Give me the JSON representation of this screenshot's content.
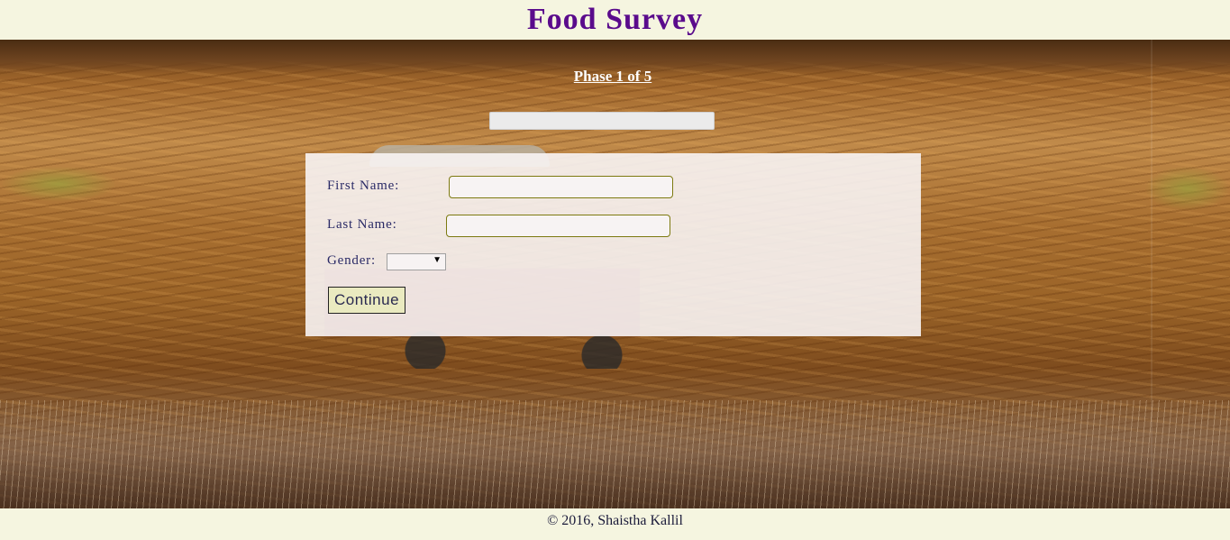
{
  "header": {
    "title": "Food Survey"
  },
  "survey": {
    "phase_label": "Phase 1 of 5",
    "progress_fraction": 0.0
  },
  "form": {
    "first_name_label": "First Name:",
    "first_name_value": "",
    "last_name_label": "Last Name:",
    "last_name_value": "",
    "gender_label": "Gender:",
    "gender_selected": "",
    "continue_label": "Continue"
  },
  "footer": {
    "copyright": "© 2016, Shaistha Kallil"
  },
  "colors": {
    "title": "#5a0b8c",
    "page_background": "#f5f5e0",
    "label_text": "#2a2a66",
    "input_border": "#7d7a10",
    "button_background": "#eaeac0"
  },
  "icons": {
    "select_arrow": "dropdown-arrow-icon"
  }
}
